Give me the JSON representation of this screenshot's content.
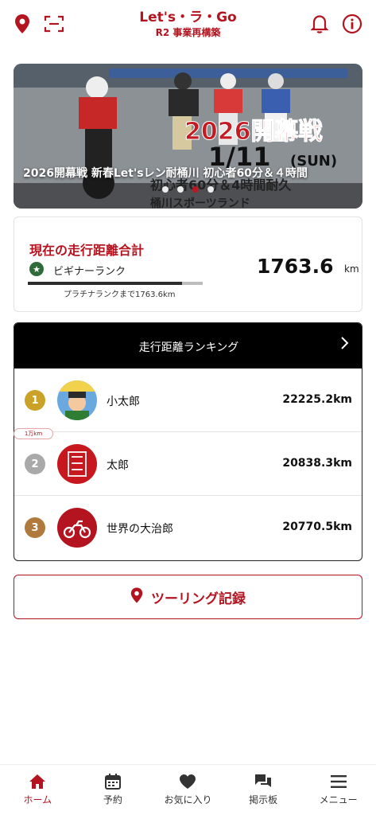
{
  "header": {
    "title": "Let's・ラ・Go",
    "subtitle": "R2 事業再構築"
  },
  "colors": {
    "brand": "#b3141f",
    "gold": "#c9a227",
    "silver": "#a9a9a9",
    "bronze": "#b07a3c",
    "rank_green": "#2f6b3a"
  },
  "icons": {
    "location": "location-pin-icon",
    "scan": "scan-frame-icon",
    "bell": "bell-icon",
    "info": "info-icon"
  },
  "banner": {
    "caption": "2026開幕戦 新春Let'sレン耐桶川 初心者60分＆４時間",
    "poster_heading": "2026開幕戦",
    "poster_date": "1/11",
    "poster_day": "(SUN)",
    "poster_line1": "初心者60分＆4時間耐久",
    "poster_line2": "桶川スポーツランド",
    "slide_count": 4,
    "active_slide": 3
  },
  "distance": {
    "title": "現在の走行距離合計",
    "rank_name": "ビギナーランク",
    "rank_progress": 0.88,
    "next_rank_text": "プラチナランクまで1763.6km",
    "value": "1763.6",
    "unit": "km"
  },
  "ranking": {
    "title": "走行距離ランキング",
    "milestone": "1万km",
    "rows": [
      {
        "rank": "1",
        "name": "小太郎",
        "km": "22225.2km"
      },
      {
        "rank": "2",
        "name": "太郎",
        "km": "20838.3km"
      },
      {
        "rank": "3",
        "name": "世界の大治郎",
        "km": "20770.5km"
      }
    ]
  },
  "touring": {
    "label": "ツーリング記録"
  },
  "nav": {
    "items": [
      {
        "label": "ホーム",
        "icon": "home-icon",
        "active": true
      },
      {
        "label": "予約",
        "icon": "calendar-icon"
      },
      {
        "label": "お気に入り",
        "icon": "heart-icon"
      },
      {
        "label": "掲示板",
        "icon": "chat-bubbles-icon"
      },
      {
        "label": "メニュー",
        "icon": "menu-icon"
      }
    ]
  }
}
